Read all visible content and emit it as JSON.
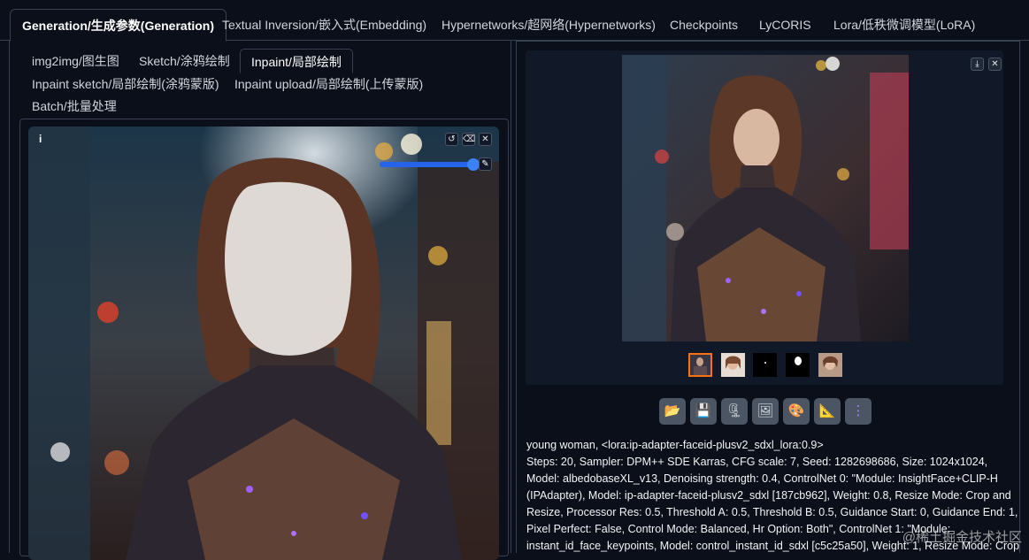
{
  "top_tabs": [
    {
      "label": "Generation/生成参数(Generation)",
      "active": true
    },
    {
      "label": "Textual Inversion/嵌入式(Embedding)"
    },
    {
      "label": "Hypernetworks/超网络(Hypernetworks)"
    },
    {
      "label": "Checkpoints"
    },
    {
      "label": "LyCORIS"
    },
    {
      "label": "Lora/低秩微调模型(LoRA)"
    }
  ],
  "sub_tabs": [
    {
      "label": "img2img/图生图"
    },
    {
      "label": "Sketch/涂鸦绘制"
    },
    {
      "label": "Inpaint/局部绘制",
      "active": true
    },
    {
      "label": "Inpaint sketch/局部绘制(涂鸦蒙版)"
    },
    {
      "label": "Inpaint upload/局部绘制(上传蒙版)"
    },
    {
      "label": "Batch/批量处理"
    }
  ],
  "editor": {
    "info_label": "i",
    "undo_icon": "undo-icon",
    "eraser_icon": "eraser-icon",
    "close_icon": "close-icon",
    "brush_icon": "brush-icon",
    "brush_size_fraction": 0.93
  },
  "gallery": {
    "download_icon": "download-icon",
    "close_icon": "close-icon",
    "thumbnail_count": 5,
    "selected_thumbnail": 1
  },
  "actions": [
    {
      "icon": "folder-icon",
      "glyph": "📂"
    },
    {
      "icon": "save-icon",
      "glyph": "💾"
    },
    {
      "icon": "zip-icon",
      "glyph": "🗜"
    },
    {
      "icon": "send-to-img2img-icon",
      "glyph": "🖼"
    },
    {
      "icon": "send-to-inpaint-icon",
      "glyph": "🎨"
    },
    {
      "icon": "send-to-extras-icon",
      "glyph": "📐"
    },
    {
      "icon": "send-to-controlnet-icon",
      "glyph": "⋮"
    }
  ],
  "generation_info": "young woman, <lora:ip-adapter-faceid-plusv2_sdxl_lora:0.9>\nSteps: 20, Sampler: DPM++ SDE Karras, CFG scale: 7, Seed: 1282698686, Size: 1024x1024, Model: albedobaseXL_v13, Denoising strength: 0.4, ControlNet 0: \"Module: InsightFace+CLIP-H (IPAdapter), Model: ip-adapter-faceid-plusv2_sdxl [187cb962], Weight: 0.8, Resize Mode: Crop and Resize, Processor Res: 0.5, Threshold A: 0.5, Threshold B: 0.5, Guidance Start: 0, Guidance End: 1, Pixel Perfect: False, Control Mode: Balanced, Hr Option: Both\", ControlNet 1: \"Module: instant_id_face_keypoints, Model: control_instant_id_sdxl [c5c25a50], Weight: 1, Resize Mode: Crop",
  "watermark": "@稀土掘金技术社区",
  "colors": {
    "accent": "#2563eb",
    "selected_thumb": "#f97316",
    "background": "#0b0f19"
  }
}
